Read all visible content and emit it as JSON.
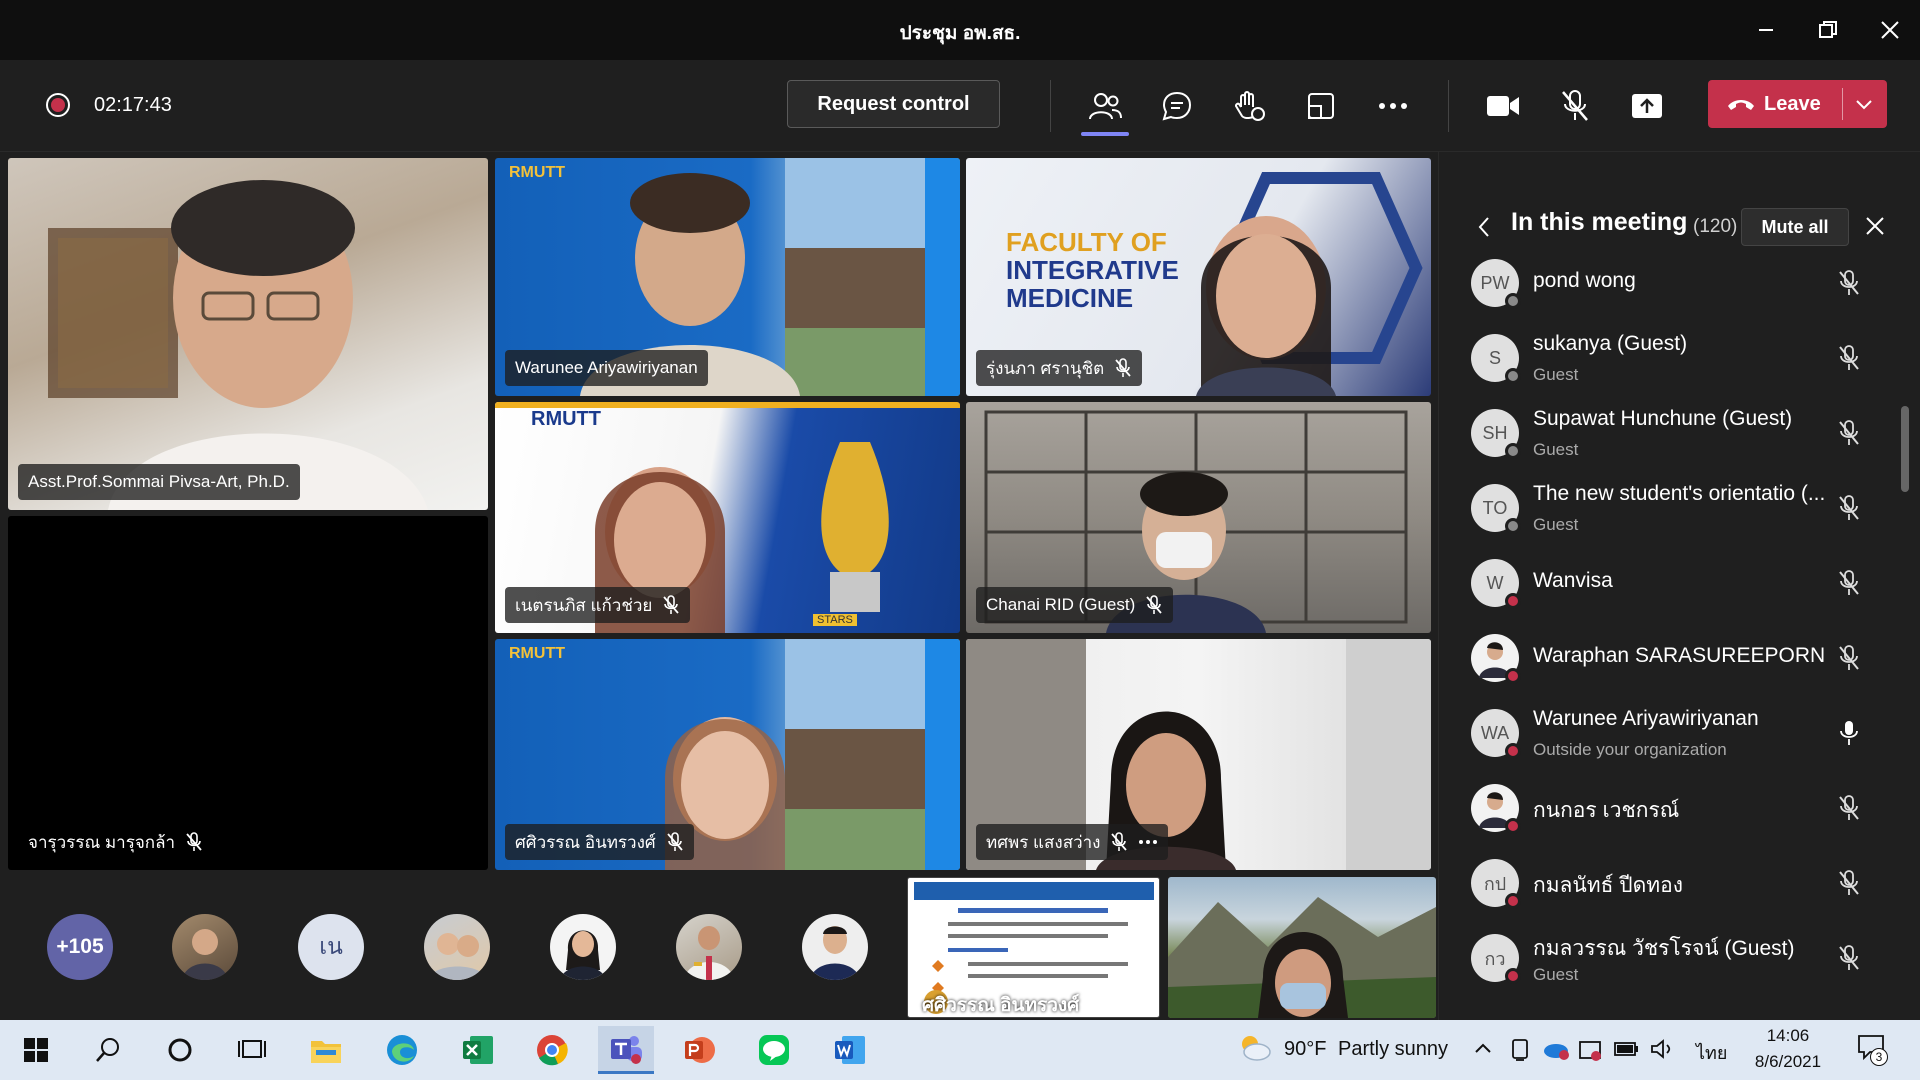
{
  "window": {
    "title": "ประชุม อพ.สธ."
  },
  "toolbar": {
    "timer": "02:17:43",
    "request_control": "Request control",
    "leave_label": "Leave",
    "leave_color": "#c4314b",
    "icons": [
      "participants-icon",
      "chat-icon",
      "raise-hand-icon",
      "rooms-icon",
      "more-icon",
      "camera-icon",
      "mic-off-icon",
      "share-icon"
    ]
  },
  "tiles": [
    {
      "name": "Asst.Prof.Sommai Pivsa-Art, Ph.D.",
      "muted": false
    },
    {
      "name": "จารุวรรณ มารุจกล้า",
      "muted": true
    },
    {
      "name": "Warunee Ariyawiriyanan",
      "muted": false
    },
    {
      "name": "รุ่งนภา ศรานุชิต",
      "muted": true
    },
    {
      "name": "เนตรนภิส แก้วช่วย",
      "muted": true
    },
    {
      "name": "Chanai RID (Guest)",
      "muted": true
    },
    {
      "name": "ศศิวรรณ อินทรวงศ์",
      "muted": true
    },
    {
      "name": "ทศพร แสงสว่าง",
      "muted": true
    }
  ],
  "tile_texts": {
    "rmutt": "RMUTT",
    "faculty_line1": "FACULTY OF",
    "faculty_line2": "INTEGRATIVE",
    "faculty_line3": "MEDICINE",
    "stars": "STARS"
  },
  "strip": {
    "overflow_count": "+105",
    "initials_avatar": "เน",
    "shared_caption": "ศศิวรรณ อินทรวงศ์"
  },
  "panel": {
    "title": "In this meeting",
    "count": "(120)",
    "mute_all": "Mute all",
    "participants": [
      {
        "initials": "PW",
        "name": "pond wong",
        "sub": "",
        "status": "#8a8a8a",
        "mic": "off"
      },
      {
        "initials": "S",
        "name": "sukanya (Guest)",
        "sub": "Guest",
        "status": "#8a8a8a",
        "mic": "off"
      },
      {
        "initials": "SH",
        "name": "Supawat Hunchune (Guest)",
        "sub": "Guest",
        "status": "#8a8a8a",
        "mic": "off"
      },
      {
        "initials": "TO",
        "name": "The new student's orientatio (...",
        "sub": "Guest",
        "status": "#8a8a8a",
        "mic": "off"
      },
      {
        "initials": "W",
        "name": "Wanvisa",
        "sub": "",
        "status": "#c4314b",
        "mic": "off"
      },
      {
        "initials": "",
        "name": "Waraphan SARASUREEPORN",
        "sub": "",
        "status": "#c4314b",
        "mic": "off"
      },
      {
        "initials": "WA",
        "name": "Warunee Ariyawiriyanan",
        "sub": "Outside your organization",
        "status": "#c4314b",
        "mic": "on"
      },
      {
        "initials": "",
        "name": "กนกอร เวชกรณ์",
        "sub": "",
        "status": "#c4314b",
        "mic": "off"
      },
      {
        "initials": "กป",
        "name": "กมลนัทธ์ ปีดทอง",
        "sub": "",
        "status": "#c4314b",
        "mic": "off"
      },
      {
        "initials": "กว",
        "name": "กมลวรรณ วัชรโรจน์ (Guest)",
        "sub": "Guest",
        "status": "#c4314b",
        "mic": "off"
      }
    ]
  },
  "taskbar": {
    "apps": [
      "windows-start-icon",
      "search-icon",
      "cortana-icon",
      "task-view-icon",
      "file-explorer-icon",
      "edge-icon",
      "excel-icon",
      "chrome-icon",
      "teams-icon",
      "powerpoint-icon",
      "line-icon",
      "word-icon"
    ],
    "weather_temp": "90°F",
    "weather_desc": "Partly sunny",
    "language": "ไทย",
    "time": "14:06",
    "date": "8/6/2021",
    "notification_count": "3"
  }
}
